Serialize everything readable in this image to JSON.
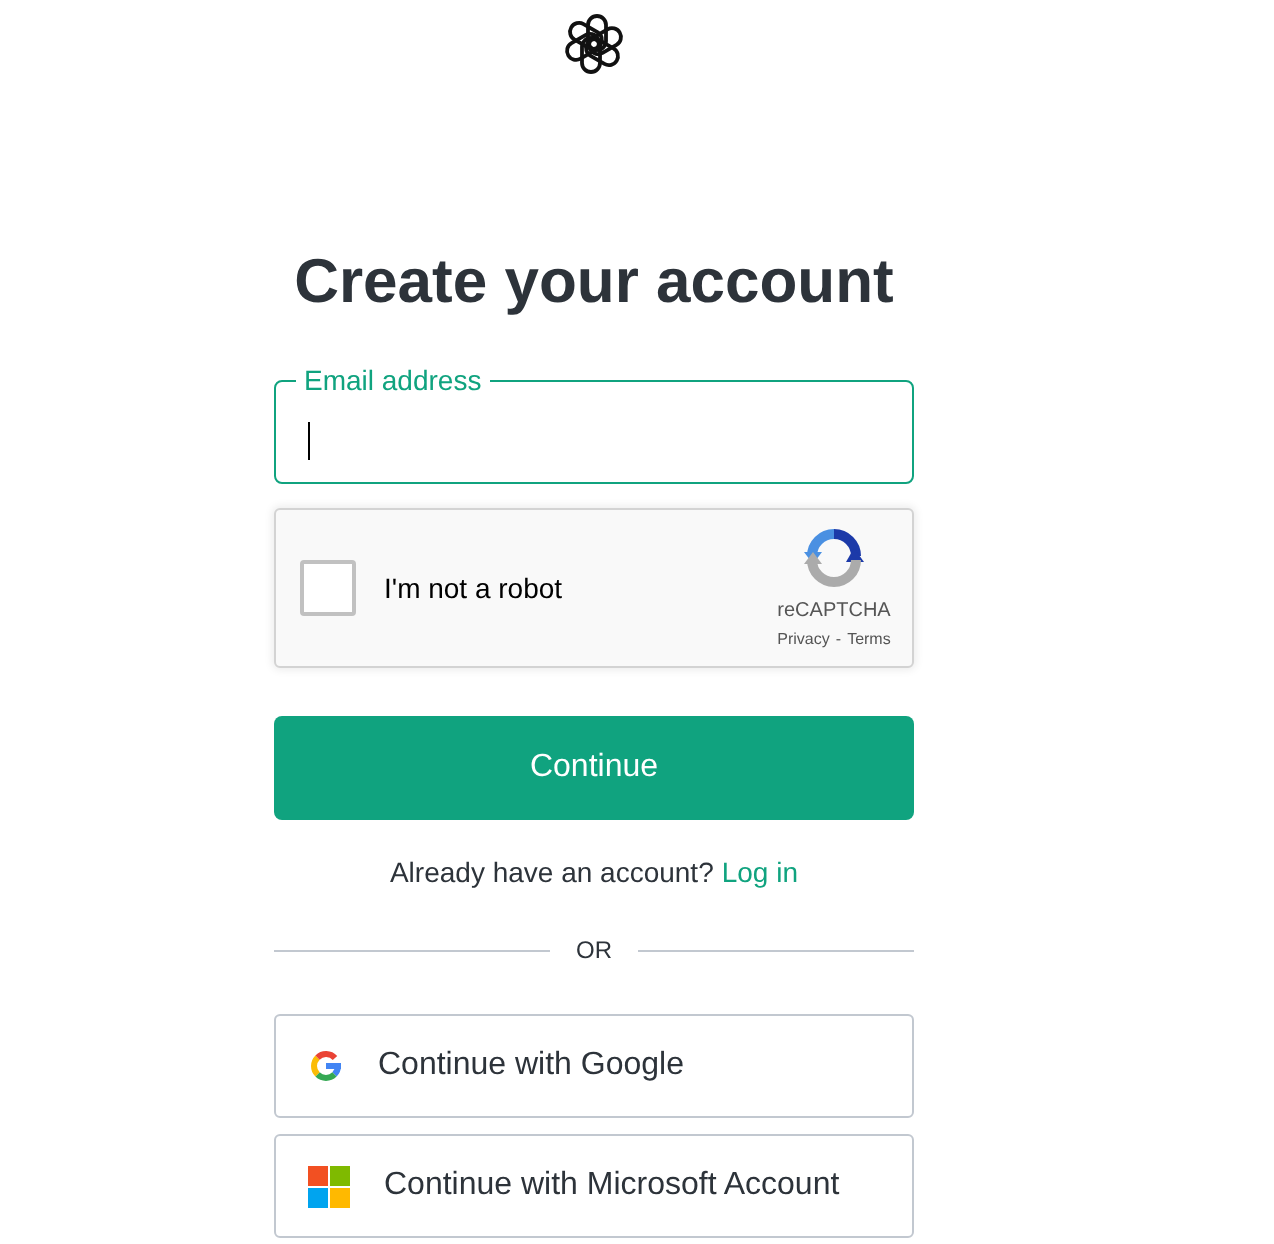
{
  "title": "Create your account",
  "email_field": {
    "label": "Email address",
    "focused": true
  },
  "captcha": {
    "label": "I'm not a robot",
    "checked": false,
    "brand": "reCAPTCHA",
    "links": [
      {
        "label": "Privacy"
      },
      {
        "label": "Terms"
      }
    ],
    "separator": "-"
  },
  "continue_button": {
    "label": "Continue"
  },
  "signin_prompt": {
    "text": "Already have an account?",
    "link": "Log in"
  },
  "divider": {
    "label": "OR"
  },
  "social_buttons": [
    {
      "kind": "google",
      "label": "Continue with Google"
    },
    {
      "kind": "microsoft",
      "label": "Continue with Microsoft Account"
    }
  ]
}
